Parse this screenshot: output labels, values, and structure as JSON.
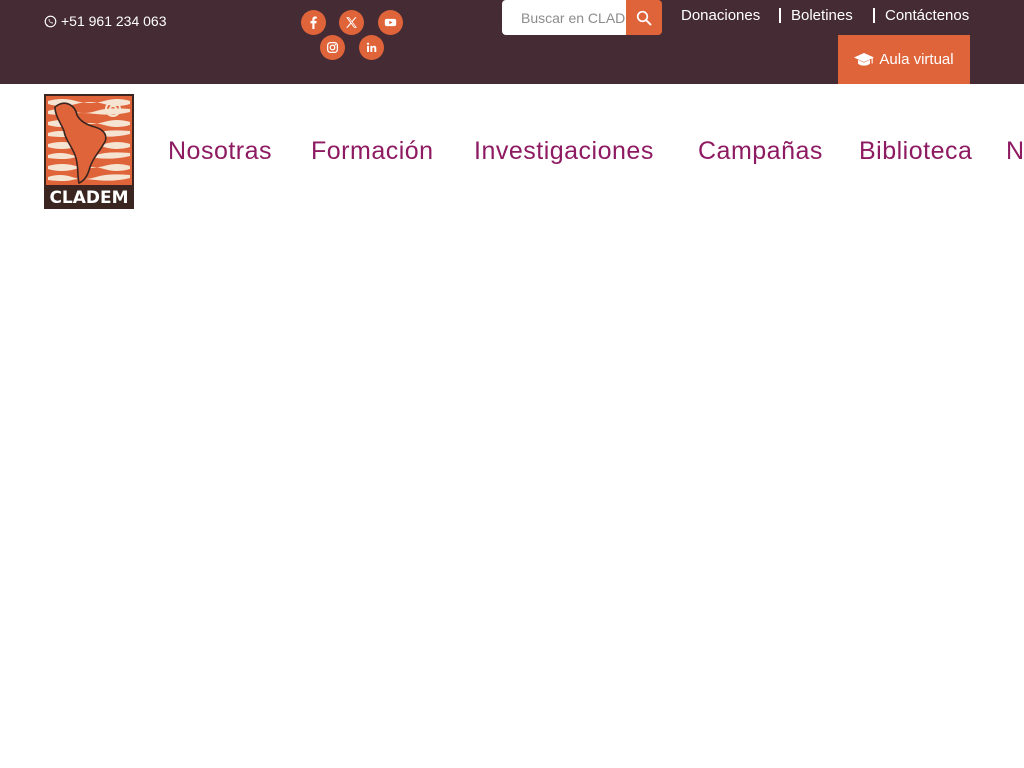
{
  "topbar": {
    "phone": "+51 961 234 063",
    "search_placeholder": "Buscar en CLADEM",
    "links": [
      "Donaciones",
      "Boletines",
      "Contáctenos"
    ],
    "aula_label": "Aula virtual"
  },
  "logo": {
    "text": "CLADEM"
  },
  "nav": {
    "items": [
      "Nosotras",
      "Formación",
      "Investigaciones",
      "Campañas",
      "Biblioteca",
      "N"
    ]
  },
  "colors": {
    "topbar_bg": "#442b34",
    "accent_orange": "#e0643a",
    "nav_text": "#8e1a62",
    "logo_dark": "#3a2520"
  },
  "icons": [
    "whatsapp-icon",
    "facebook-icon",
    "x-twitter-icon",
    "youtube-icon",
    "instagram-icon",
    "linkedin-icon",
    "search-icon",
    "graduation-cap-icon"
  ]
}
